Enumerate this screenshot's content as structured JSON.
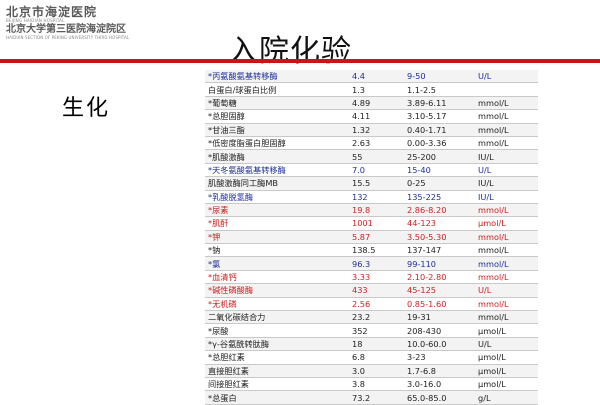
{
  "header": {
    "logo_cn_1": "北京市海淀医院",
    "logo_en_1": "BEIJING HAIDIAN HOSPITAL",
    "logo_cn_2": "北京大学第三医院海淀院区",
    "logo_en_2": "HAIDIAN SECTION OF PEKING UNIVERSITY THIRD HOSPITAL",
    "title": "入院化验",
    "accent_color": "#c8141e"
  },
  "section": {
    "label": "生化"
  },
  "table": {
    "rows": [
      {
        "name": "*丙氨酸氨基转移酶",
        "value": "4.4",
        "ref": "9-50",
        "unit": "U/L",
        "status": "blue"
      },
      {
        "name": "白蛋白/球蛋白比例",
        "value": "1.3",
        "ref": "1.1-2.5",
        "unit": "",
        "status": "normal"
      },
      {
        "name": "*葡萄糖",
        "value": "4.89",
        "ref": "3.89-6.11",
        "unit": "mmol/L",
        "status": "normal"
      },
      {
        "name": "*总胆固醇",
        "value": "4.11",
        "ref": "3.10-5.17",
        "unit": "mmol/L",
        "status": "normal"
      },
      {
        "name": "*甘油三酯",
        "value": "1.32",
        "ref": "0.40-1.71",
        "unit": "mmol/L",
        "status": "normal"
      },
      {
        "name": "*低密度脂蛋白胆固醇",
        "value": "2.63",
        "ref": "0.00-3.36",
        "unit": "mmol/L",
        "status": "normal"
      },
      {
        "name": "*肌酸激酶",
        "value": "55",
        "ref": "25-200",
        "unit": "IU/L",
        "status": "normal"
      },
      {
        "name": "*天冬氨酸氨基转移酶",
        "value": "7.0",
        "ref": "15-40",
        "unit": "U/L",
        "status": "blue"
      },
      {
        "name": "肌酸激酶同工酶MB",
        "value": "15.5",
        "ref": "0-25",
        "unit": "IU/L",
        "status": "normal"
      },
      {
        "name": "*乳酸脱氢酶",
        "value": "132",
        "ref": "135-225",
        "unit": "IU/L",
        "status": "blue"
      },
      {
        "name": "*尿素",
        "value": "19.8",
        "ref": "2.86-8.20",
        "unit": "mmol/L",
        "status": "red"
      },
      {
        "name": "*肌酐",
        "value": "1001",
        "ref": "44-123",
        "unit": "μmol/L",
        "status": "red"
      },
      {
        "name": "*钾",
        "value": "5.87",
        "ref": "3.50-5.30",
        "unit": "mmol/L",
        "status": "red"
      },
      {
        "name": "*钠",
        "value": "138.5",
        "ref": "137-147",
        "unit": "mmol/L",
        "status": "normal"
      },
      {
        "name": "*氯",
        "value": "96.3",
        "ref": "99-110",
        "unit": "mmol/L",
        "status": "blue"
      },
      {
        "name": "*血清钙",
        "value": "3.33",
        "ref": "2.10-2.80",
        "unit": "mmol/L",
        "status": "red"
      },
      {
        "name": "*碱性磷酸酶",
        "value": "433",
        "ref": "45-125",
        "unit": "U/L",
        "status": "red"
      },
      {
        "name": "*无机磷",
        "value": "2.56",
        "ref": "0.85-1.60",
        "unit": "mmol/L",
        "status": "red"
      },
      {
        "name": "二氧化碳结合力",
        "value": "23.2",
        "ref": "19-31",
        "unit": "mmol/L",
        "status": "normal"
      },
      {
        "name": "*尿酸",
        "value": "352",
        "ref": "208-430",
        "unit": "μmol/L",
        "status": "normal"
      },
      {
        "name": "*γ-谷氨酰转肽酶",
        "value": "18",
        "ref": "10.0-60.0",
        "unit": "U/L",
        "status": "normal"
      },
      {
        "name": "*总胆红素",
        "value": "6.8",
        "ref": "3-23",
        "unit": "μmol/L",
        "status": "normal"
      },
      {
        "name": "直接胆红素",
        "value": "3.0",
        "ref": "1.7-6.8",
        "unit": "μmol/L",
        "status": "normal"
      },
      {
        "name": "间接胆红素",
        "value": "3.8",
        "ref": "3.0-16.0",
        "unit": "μmol/L",
        "status": "normal"
      },
      {
        "name": "*总蛋白",
        "value": "73.2",
        "ref": "65.0-85.0",
        "unit": "g/L",
        "status": "normal"
      }
    ]
  }
}
